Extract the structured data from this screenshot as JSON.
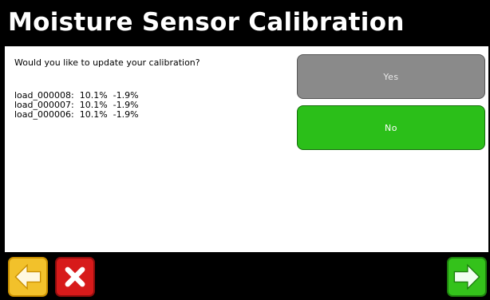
{
  "screen": {
    "title": "Moisture Sensor Calibration"
  },
  "content": {
    "question": "Would you like to update your calibration?",
    "loads": [
      "load_000008:  10.1%  -1.9%",
      "load_000007:  10.1%  -1.9%",
      "load_000006:  10.1%  -1.9%"
    ]
  },
  "buttons": {
    "yes_label": "Yes",
    "no_label": "No"
  },
  "footer": {
    "back_icon": "arrow-left-icon",
    "cancel_icon": "x-icon",
    "next_icon": "arrow-right-icon"
  },
  "colors": {
    "yes_button": "#8a8a8a",
    "no_button": "#2bbf19",
    "back_button": "#f2c12b",
    "cancel_button": "#d71a1a",
    "next_button": "#34c21b"
  }
}
